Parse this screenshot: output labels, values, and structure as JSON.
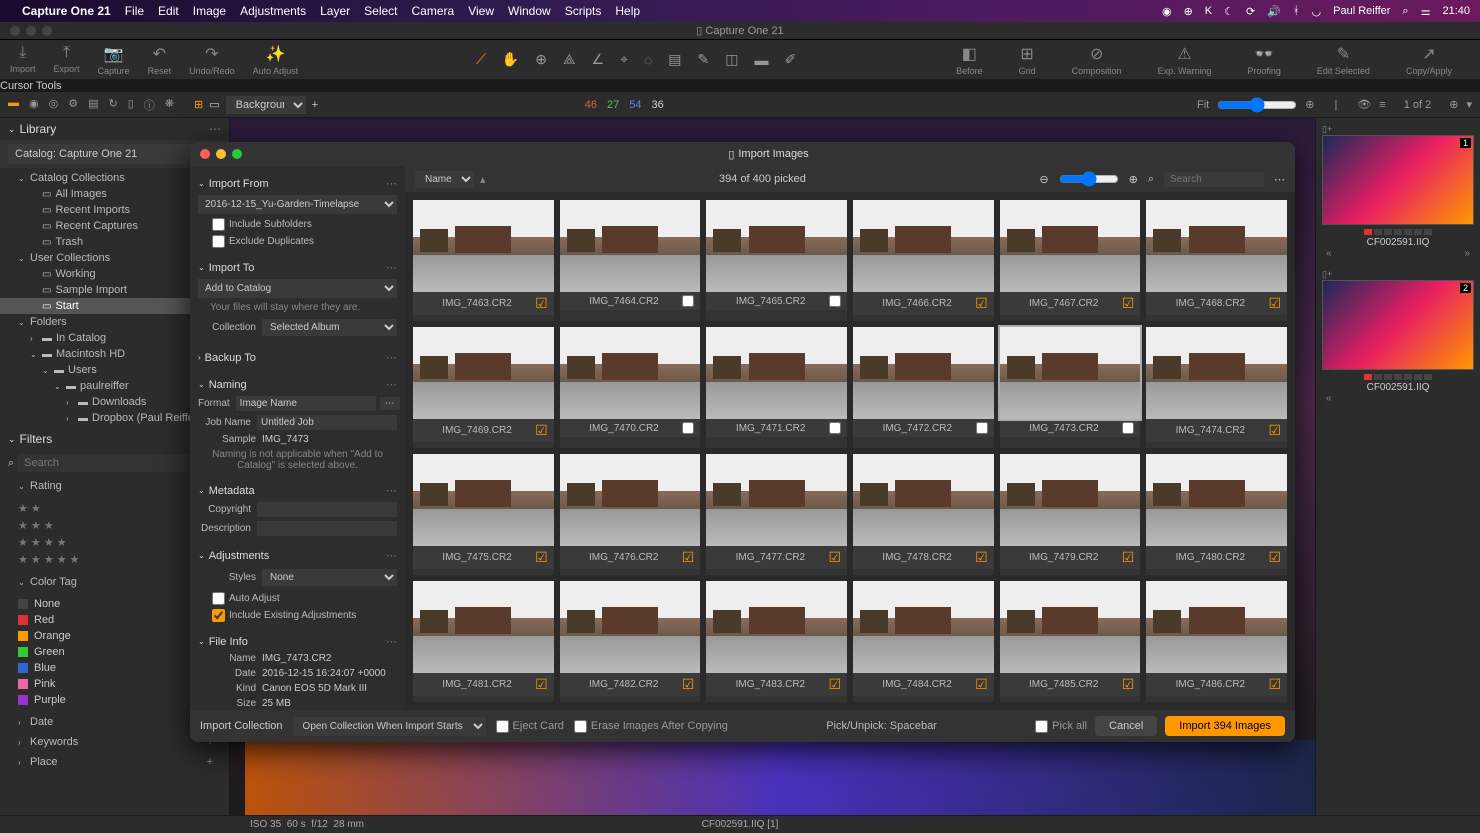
{
  "menubar": {
    "app": "Capture One 21",
    "items": [
      "File",
      "Edit",
      "Image",
      "Adjustments",
      "Layer",
      "Select",
      "Camera",
      "View",
      "Window",
      "Scripts",
      "Help"
    ],
    "user": "Paul Reiffer",
    "time": "21:40"
  },
  "titlebar": {
    "title": "Capture One 21"
  },
  "toolbar": {
    "left": [
      {
        "icon": "⤓",
        "label": "Import"
      },
      {
        "icon": "⤒",
        "label": "Export"
      },
      {
        "icon": "📷",
        "label": "Capture"
      },
      {
        "icon": "↶",
        "label": "Reset"
      },
      {
        "icon": "↷",
        "label": "Undo/Redo"
      },
      {
        "icon": "✨",
        "label": "Auto Adjust"
      }
    ],
    "center_label": "Cursor Tools",
    "right": [
      {
        "icon": "◧",
        "label": "Before"
      },
      {
        "icon": "⊞",
        "label": "Grid"
      },
      {
        "icon": "⊘",
        "label": "Composition"
      },
      {
        "icon": "⚠",
        "label": "Exp. Warning"
      },
      {
        "icon": "👓",
        "label": "Proofing"
      },
      {
        "icon": "✎",
        "label": "Edit Selected"
      },
      {
        "icon": "↗",
        "label": "Copy/Apply"
      }
    ]
  },
  "subbar": {
    "background_label": "Background",
    "counts": [
      {
        "val": "46",
        "color": "#e05a5a"
      },
      {
        "val": "27",
        "color": "#5ac05a"
      },
      {
        "val": "54",
        "color": "#5a8ae0"
      },
      {
        "val": "36",
        "color": "#ccc"
      }
    ],
    "fit": "Fit",
    "pager": "1 of 2"
  },
  "sidebar": {
    "library": "Library",
    "catalog": "Catalog: Capture One 21",
    "collections_hdr": "Catalog Collections",
    "collections": [
      "All Images",
      "Recent Imports",
      "Recent Captures",
      "Trash"
    ],
    "user_collections_hdr": "User Collections",
    "user_collections": [
      "Working",
      "Sample Import",
      "Start"
    ],
    "selected_user_collection": "Start",
    "folders_hdr": "Folders",
    "folders": [
      {
        "name": "In Catalog",
        "indent": 1
      },
      {
        "name": "Macintosh HD",
        "indent": 1,
        "exp": true
      },
      {
        "name": "Users",
        "indent": 2,
        "exp": true
      },
      {
        "name": "paulreiffer",
        "indent": 3,
        "exp": true
      },
      {
        "name": "Downloads",
        "indent": 4
      },
      {
        "name": "Dropbox (Paul Reiffer)",
        "indent": 4
      }
    ],
    "filters_hdr": "Filters",
    "search_placeholder": "Search",
    "rating_hdr": "Rating",
    "color_tag_hdr": "Color Tag",
    "colors": [
      {
        "name": "None",
        "hex": "#444"
      },
      {
        "name": "Red",
        "hex": "#d33"
      },
      {
        "name": "Orange",
        "hex": "#f90"
      },
      {
        "name": "Green",
        "hex": "#3c3"
      },
      {
        "name": "Blue",
        "hex": "#36c"
      },
      {
        "name": "Pink",
        "hex": "#e6a"
      },
      {
        "name": "Purple",
        "hex": "#93c"
      }
    ],
    "lower_sections": [
      "Date",
      "Keywords",
      "Place"
    ]
  },
  "right_panel": {
    "thumbs": [
      {
        "num": "1",
        "name": "CF002591.IIQ"
      },
      {
        "num": "2",
        "name": "CF002591.IIQ"
      }
    ]
  },
  "modal": {
    "title": "Import Images",
    "import_from": {
      "hdr": "Import From",
      "source": "2016-12-15_Yu-Garden-Timelapse",
      "include_subfolders": "Include Subfolders",
      "exclude_duplicates": "Exclude Duplicates"
    },
    "import_to": {
      "hdr": "Import To",
      "dest": "Add to Catalog",
      "note": "Your files will stay where they are.",
      "collection_lbl": "Collection",
      "collection_val": "Selected Album"
    },
    "backup_hdr": "Backup To",
    "naming": {
      "hdr": "Naming",
      "format_lbl": "Format",
      "format_val": "Image Name",
      "jobname_lbl": "Job Name",
      "jobname_val": "Untitled Job",
      "sample_lbl": "Sample",
      "sample_val": "IMG_7473",
      "note": "Naming is not applicable when \"Add to Catalog\" is selected above."
    },
    "metadata": {
      "hdr": "Metadata",
      "copyright_lbl": "Copyright",
      "description_lbl": "Description"
    },
    "adjustments": {
      "hdr": "Adjustments",
      "styles_lbl": "Styles",
      "styles_val": "None",
      "auto_adjust": "Auto Adjust",
      "include_existing": "Include Existing Adjustments"
    },
    "fileinfo": {
      "hdr": "File Info",
      "name_lbl": "Name",
      "name_val": "IMG_7473.CR2",
      "date_lbl": "Date",
      "date_val": "2016-12-15 16:24:07 +0000",
      "kind_lbl": "Kind",
      "kind_val": "Canon EOS 5D Mark III",
      "size_lbl": "Size",
      "size_val": "25 MB"
    },
    "grid_toolbar": {
      "sort": "Name",
      "picked": "394 of 400 picked",
      "search_placeholder": "Search"
    },
    "thumbs": [
      {
        "name": "IMG_7463.CR2",
        "picked": true
      },
      {
        "name": "IMG_7464.CR2",
        "picked": false
      },
      {
        "name": "IMG_7465.CR2",
        "picked": false
      },
      {
        "name": "IMG_7466.CR2",
        "picked": true
      },
      {
        "name": "IMG_7467.CR2",
        "picked": true
      },
      {
        "name": "IMG_7468.CR2",
        "picked": true
      },
      {
        "name": "IMG_7469.CR2",
        "picked": true
      },
      {
        "name": "IMG_7470.CR2",
        "picked": false
      },
      {
        "name": "IMG_7471.CR2",
        "picked": false
      },
      {
        "name": "IMG_7472.CR2",
        "picked": false
      },
      {
        "name": "IMG_7473.CR2",
        "picked": false,
        "sel": true
      },
      {
        "name": "IMG_7474.CR2",
        "picked": true
      },
      {
        "name": "IMG_7475.CR2",
        "picked": true
      },
      {
        "name": "IMG_7476.CR2",
        "picked": true
      },
      {
        "name": "IMG_7477.CR2",
        "picked": true
      },
      {
        "name": "IMG_7478.CR2",
        "picked": true
      },
      {
        "name": "IMG_7479.CR2",
        "picked": true
      },
      {
        "name": "IMG_7480.CR2",
        "picked": true
      },
      {
        "name": "IMG_7481.CR2",
        "picked": true
      },
      {
        "name": "IMG_7482.CR2",
        "picked": true
      },
      {
        "name": "IMG_7483.CR2",
        "picked": true
      },
      {
        "name": "IMG_7484.CR2",
        "picked": true
      },
      {
        "name": "IMG_7485.CR2",
        "picked": true
      },
      {
        "name": "IMG_7486.CR2",
        "picked": true
      }
    ],
    "footer": {
      "import_collection_lbl": "Import Collection",
      "import_collection_val": "Open Collection When Import Starts",
      "eject": "Eject Card",
      "erase": "Erase Images After Copying",
      "hint": "Pick/Unpick: Spacebar",
      "pick_all": "Pick all",
      "cancel": "Cancel",
      "import_btn": "Import 394 Images"
    }
  },
  "statusbar": {
    "iso": "ISO 35",
    "shutter": "60 s",
    "aperture": "f/12",
    "focal": "28 mm",
    "filename": "CF002591.IIQ [1]"
  }
}
